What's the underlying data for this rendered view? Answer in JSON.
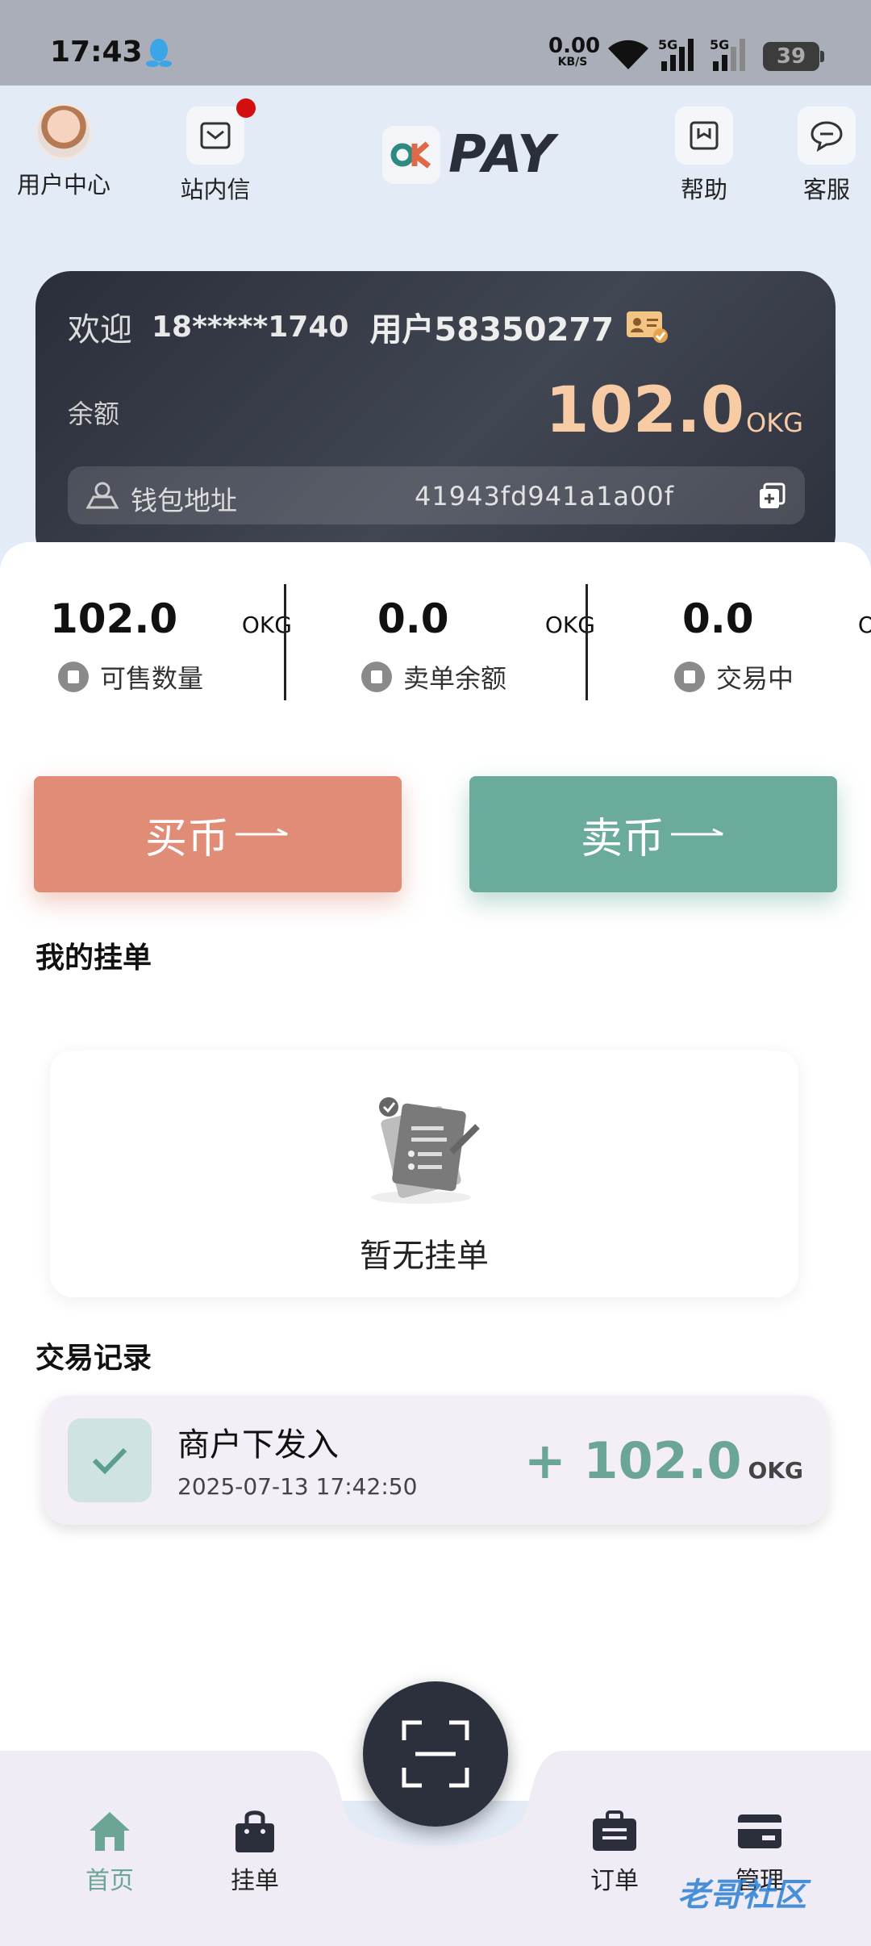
{
  "status_bar": {
    "time": "17:43",
    "net_speed_value": "0.00",
    "net_speed_unit": "KB/S",
    "signal_label_1": "5G",
    "signal_label_2": "5G",
    "battery": "39"
  },
  "top_nav": {
    "user_center": "用户中心",
    "messages": "站内信",
    "help": "帮助",
    "service": "客服",
    "logo_text": "PAY"
  },
  "wallet": {
    "welcome": "欢迎",
    "phone": "18*****1740",
    "username": "用户58350277",
    "balance_label": "余额",
    "balance_value": "102.0",
    "balance_unit": "OKG",
    "address_label": "钱包地址",
    "address_value": "41943fd941a1a00f"
  },
  "stats": [
    {
      "value": "102.0",
      "unit": "OKG",
      "label": "可售数量"
    },
    {
      "value": "0.0",
      "unit": "OKG",
      "label": "卖单余额"
    },
    {
      "value": "0.0",
      "unit": "OKG",
      "label": "交易中"
    }
  ],
  "actions": {
    "buy": "买币",
    "sell": "卖币"
  },
  "my_orders": {
    "title": "我的挂单",
    "empty_text": "暂无挂单"
  },
  "records": {
    "title": "交易记录",
    "items": [
      {
        "title": "商户下发入",
        "time": "2025-07-13 17:42:50",
        "amount": "+ 102.0",
        "unit": "OKG"
      }
    ]
  },
  "bottom_nav": {
    "home": "首页",
    "orders_listed": "挂单",
    "orders": "订单",
    "manage": "管理"
  },
  "watermark": "老哥社区",
  "colors": {
    "accent_green": "#6aa596",
    "buy_button": "#e08c77",
    "sell_button": "#6aab9c",
    "card_dark": "#2e323e",
    "balance_gold": "#f7cba4"
  },
  "icons": [
    "qq-icon",
    "wifi-icon",
    "signal-icon",
    "battery-icon",
    "mail-icon",
    "help-icon",
    "chat-icon",
    "id-card-icon",
    "map-pin-icon",
    "copy-icon",
    "check-icon",
    "document-icon",
    "home-icon",
    "bag-icon",
    "scan-icon",
    "briefcase-icon",
    "card-icon",
    "arrow-right-icon"
  ]
}
